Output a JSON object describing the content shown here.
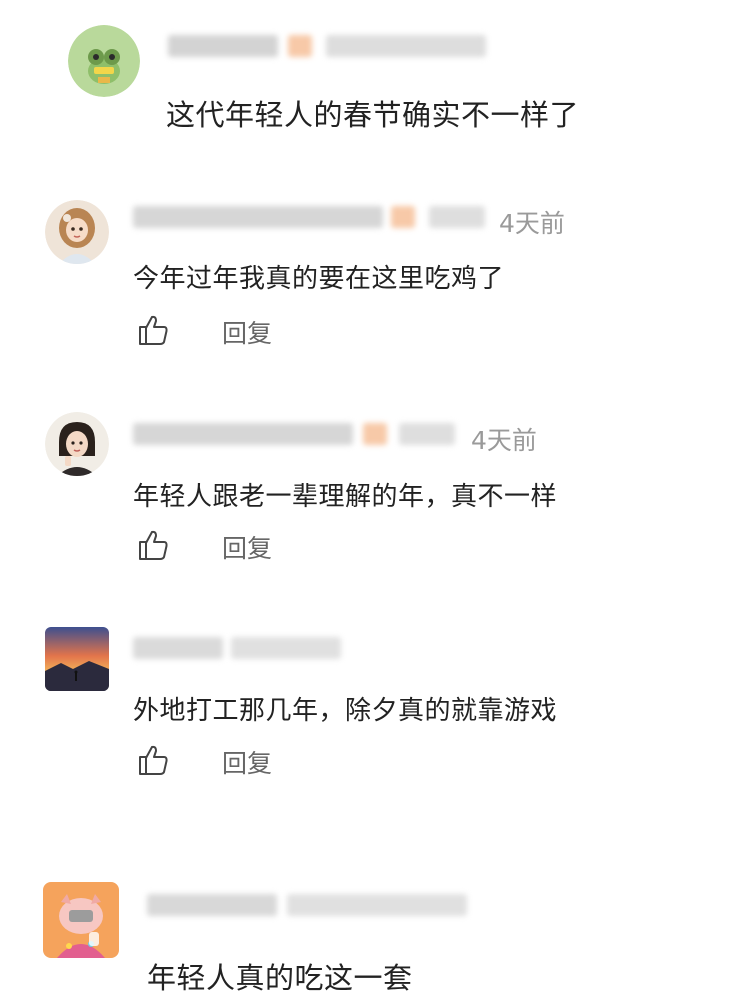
{
  "comments": [
    {
      "username": "",
      "time": "",
      "text": "这代年轻人的春节确实不一样了",
      "like_icon": "thumb-up-icon",
      "reply_label": "",
      "avatar": "cartoon-frog-avatar"
    },
    {
      "username": "",
      "time": "4天前",
      "text": "今年过年我真的要在这里吃鸡了",
      "like_icon": "thumb-up-icon",
      "reply_label": "回复",
      "avatar": "girl-illustration-avatar"
    },
    {
      "username": "",
      "time": "4天前",
      "text": "年轻人跟老一辈理解的年，真不一样",
      "like_icon": "thumb-up-icon",
      "reply_label": "回复",
      "avatar": "girl-portrait-avatar"
    },
    {
      "username": "",
      "time": "",
      "text": "外地打工那几年，除夕真的就靠游戏",
      "like_icon": "thumb-up-icon",
      "reply_label": "回复",
      "avatar": "sunset-landscape-avatar"
    },
    {
      "username": "",
      "time": "",
      "text": "年轻人真的吃这一套",
      "like_icon": "thumb-up-icon",
      "reply_label": "",
      "avatar": "pig-cartoon-avatar"
    }
  ],
  "colors": {
    "text": "#222222",
    "time": "#9a9a9a",
    "reply": "#666666",
    "blur_gray": "#d8d8d8",
    "blur_orange": "#f7c9a8"
  }
}
